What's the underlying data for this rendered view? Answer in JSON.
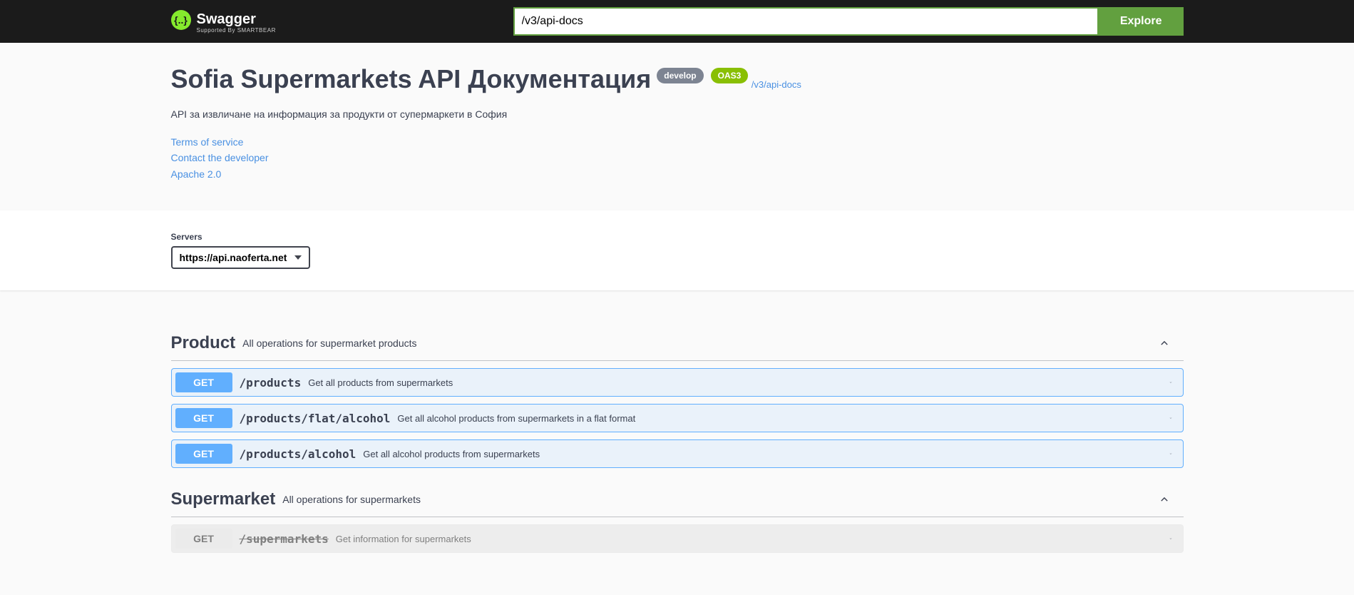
{
  "topbar": {
    "logo_text": "Swagger",
    "logo_sub": "Supported By SMARTBEAR",
    "url_value": "/v3/api-docs",
    "explore_label": "Explore"
  },
  "info": {
    "title": "Sofia Supermarkets API Документация",
    "version": "develop",
    "oas_badge": "OAS3",
    "base_url": "/v3/api-docs",
    "description": "API за извличане на информация за продукти от супермаркети в София",
    "terms_label": "Terms of service",
    "contact_label": "Contact the developer",
    "license_label": "Apache 2.0"
  },
  "servers": {
    "label": "Servers",
    "selected": "https://api.naoferta.net"
  },
  "tags": [
    {
      "name": "Product",
      "description": "All operations for supermarket products",
      "operations": [
        {
          "method": "GET",
          "path": "/products",
          "summary": "Get all products from supermarkets",
          "deprecated": false
        },
        {
          "method": "GET",
          "path": "/products/flat/alcohol",
          "summary": "Get all alcohol products from supermarkets in a flat format",
          "deprecated": false
        },
        {
          "method": "GET",
          "path": "/products/alcohol",
          "summary": "Get all alcohol products from supermarkets",
          "deprecated": false
        }
      ]
    },
    {
      "name": "Supermarket",
      "description": "All operations for supermarkets",
      "operations": [
        {
          "method": "GET",
          "path": "/supermarkets",
          "summary": "Get information for supermarkets",
          "deprecated": true
        }
      ]
    }
  ]
}
